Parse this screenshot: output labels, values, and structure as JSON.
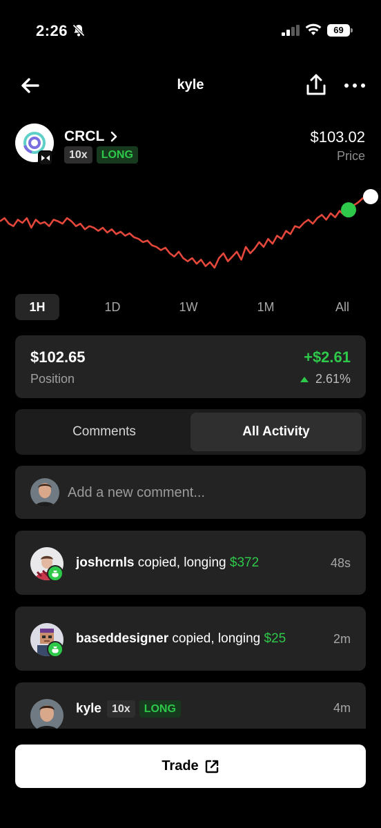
{
  "status_bar": {
    "time": "2:26",
    "battery": "69"
  },
  "nav": {
    "title": "kyle",
    "back_icon": "arrow-left-icon",
    "share_icon": "share-icon",
    "more_icon": "more-dots-icon"
  },
  "ticker": {
    "symbol": "CRCL",
    "leverage": "10x",
    "direction": "LONG",
    "price": "$103.02",
    "price_label": "Price"
  },
  "chart_data": {
    "type": "line",
    "series": [
      {
        "values": [
          0.58,
          0.62,
          0.55,
          0.52,
          0.6,
          0.56,
          0.62,
          0.5,
          0.6,
          0.55,
          0.57,
          0.52,
          0.6,
          0.58,
          0.55,
          0.62,
          0.58,
          0.52,
          0.55,
          0.48,
          0.52,
          0.5,
          0.46,
          0.5,
          0.44,
          0.48,
          0.42,
          0.45,
          0.4,
          0.43,
          0.38,
          0.36,
          0.32,
          0.34,
          0.28,
          0.26,
          0.22,
          0.25,
          0.18,
          0.14,
          0.2,
          0.12,
          0.08,
          0.12,
          0.05,
          0.1,
          0.02,
          0.07,
          0.0,
          0.12,
          0.18,
          0.08,
          0.14,
          0.2,
          0.1,
          0.26,
          0.18,
          0.24,
          0.32,
          0.26,
          0.36,
          0.3,
          0.4,
          0.36,
          0.46,
          0.42,
          0.52,
          0.5,
          0.56,
          0.6,
          0.55,
          0.62,
          0.66,
          0.6,
          0.68,
          0.63,
          0.71,
          0.66,
          0.74
        ]
      }
    ],
    "line_color": "#e5473b",
    "current_marker_color": "#2ec84a"
  },
  "ranges": {
    "items": [
      "1H",
      "1D",
      "1W",
      "1M",
      "All"
    ],
    "active": "1H"
  },
  "position": {
    "value": "$102.65",
    "label": "Position",
    "pnl": "+$2.61",
    "pnl_pct": "2.61%"
  },
  "tabs": {
    "comments": "Comments",
    "all_activity": "All Activity",
    "active": "All Activity"
  },
  "comment": {
    "placeholder": "Add a new comment..."
  },
  "activity": [
    {
      "user": "joshcrnls",
      "action": " copied, longing ",
      "amount": "$372",
      "time": "48s"
    },
    {
      "user": "baseddesigner",
      "action": " copied, longing ",
      "amount": "$25",
      "time": "2m"
    },
    {
      "user": "kyle",
      "leverage": "10x",
      "direction": "LONG",
      "time": "4m"
    }
  ],
  "trade_button": {
    "label": "Trade",
    "icon": "external-link-icon"
  },
  "colors": {
    "accent_green": "#2ec84a",
    "line_red": "#e5473b",
    "card_bg": "#232323"
  }
}
